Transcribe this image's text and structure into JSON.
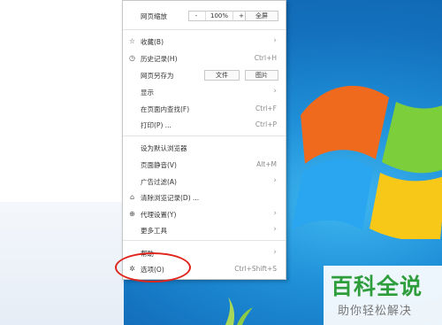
{
  "zoom_row": {
    "label": "网页缩放",
    "minus": "-",
    "value": "100%",
    "plus": "+",
    "fullscreen": "全屏"
  },
  "menu_items": {
    "favorites": {
      "label": "收藏(B)",
      "icon": "star-icon"
    },
    "history": {
      "label": "历史记录(H)",
      "shortcut": "Ctrl+H",
      "icon": "clock-icon"
    },
    "save_as": {
      "label": "网页另存为",
      "file_btn": "文件",
      "image_btn": "图片"
    },
    "display": {
      "label": "显示"
    },
    "find": {
      "label": "在页面内查找(F)",
      "shortcut": "Ctrl+F"
    },
    "print": {
      "label": "打印(P) ...",
      "shortcut": "Ctrl+P"
    },
    "default_browser": {
      "label": "设为默认浏览器"
    },
    "mute": {
      "label": "页面静音(V)",
      "shortcut": "Alt+M"
    },
    "ad_filter": {
      "label": "广告过滤(A)"
    },
    "clear_history": {
      "label": "清除浏览记录(D) ...",
      "icon": "broom-icon"
    },
    "proxy": {
      "label": "代理设置(Y)",
      "icon": "globe-icon"
    },
    "more_tools": {
      "label": "更多工具"
    },
    "help": {
      "label": "帮助"
    },
    "options": {
      "label": "选项(O)",
      "shortcut": "Ctrl+Shift+S",
      "icon": "gear-icon"
    }
  },
  "watermark": {
    "title": "百科全说",
    "subtitle": "助你轻松解决"
  },
  "colors": {
    "highlight_ellipse": "#e0231b",
    "watermark_green": "#2e9e3c",
    "desktop_blue": "#1f8fd8"
  }
}
